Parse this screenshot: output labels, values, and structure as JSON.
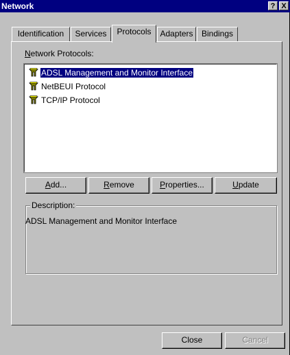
{
  "window": {
    "title": "Network",
    "help_glyph": "?",
    "close_glyph": "X"
  },
  "tabs": [
    {
      "label": "Identification"
    },
    {
      "label": "Services"
    },
    {
      "label": "Protocols"
    },
    {
      "label": "Adapters"
    },
    {
      "label": "Bindings"
    }
  ],
  "active_tab": "Protocols",
  "protocols": {
    "label": "Network Protocols:",
    "items": [
      {
        "label": "ADSL Management and Monitor Interface",
        "icon": "network-protocol-icon",
        "selected": true
      },
      {
        "label": "NetBEUI Protocol",
        "icon": "network-protocol-icon",
        "selected": false
      },
      {
        "label": "TCP/IP Protocol",
        "icon": "network-protocol-icon",
        "selected": false
      }
    ]
  },
  "buttons": {
    "add": "Add...",
    "remove": "Remove",
    "properties": "Properties...",
    "update": "Update"
  },
  "description": {
    "title": "Description:",
    "text": "ADSL Management and Monitor Interface"
  },
  "footer": {
    "close": "Close",
    "cancel": "Cancel"
  },
  "colors": {
    "titlebar": "#000080",
    "face": "#c0c0c0",
    "selection": "#000080"
  }
}
